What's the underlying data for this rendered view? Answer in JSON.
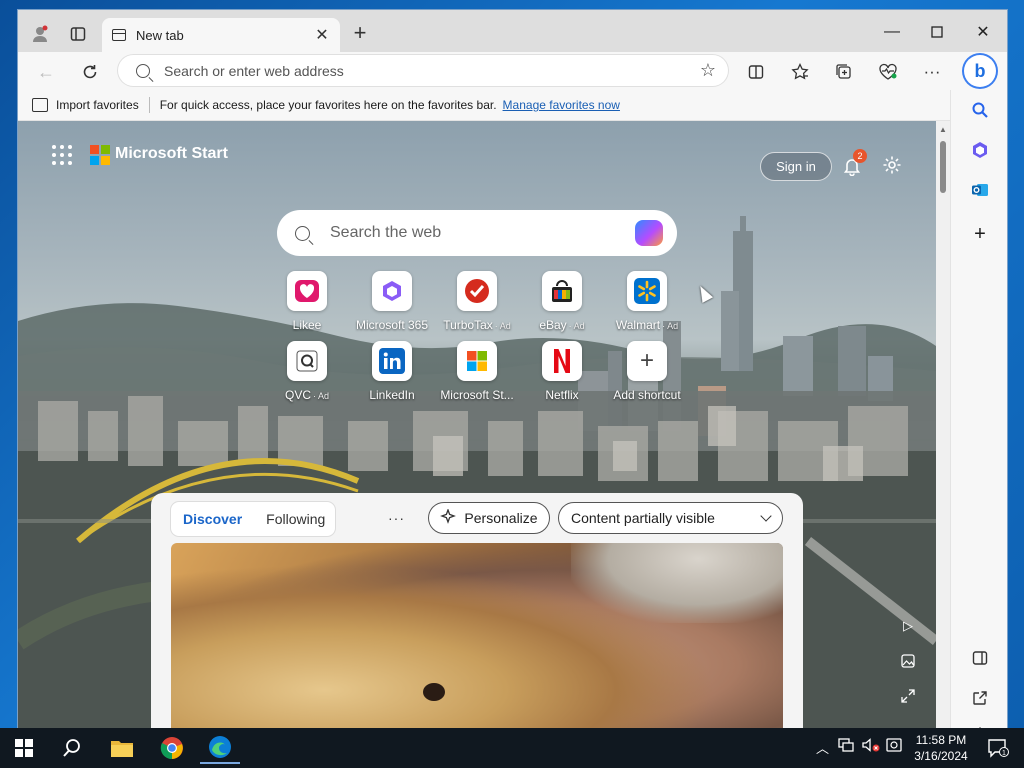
{
  "tab": {
    "title": "New tab"
  },
  "address": {
    "placeholder": "Search or enter web address"
  },
  "favorites_bar": {
    "import_label": "Import favorites",
    "message": "For quick access, place your favorites here on the favorites bar.",
    "manage_link": "Manage favorites now"
  },
  "page": {
    "brand": "Microsoft Start",
    "sign_in": "Sign in",
    "notification_count": "2",
    "search_placeholder": "Search the web"
  },
  "shortcuts": [
    {
      "label": "Likee",
      "ad": ""
    },
    {
      "label": "Microsoft 365",
      "ad": ""
    },
    {
      "label": "TurboTax",
      "ad": "Ad"
    },
    {
      "label": "eBay",
      "ad": "Ad"
    },
    {
      "label": "Walmart",
      "ad": "Ad"
    },
    {
      "label": "QVC",
      "ad": "Ad"
    },
    {
      "label": "LinkedIn",
      "ad": ""
    },
    {
      "label": "Microsoft St...",
      "ad": ""
    },
    {
      "label": "Netflix",
      "ad": ""
    },
    {
      "label": "Add shortcut",
      "ad": ""
    }
  ],
  "feed": {
    "tabs": [
      {
        "label": "Discover",
        "active": true
      },
      {
        "label": "Following",
        "active": false
      }
    ],
    "more": "···",
    "personalize": "Personalize",
    "content_visibility": "Content partially visible"
  },
  "taskbar": {
    "time": "11:58 PM",
    "date": "3/16/2024",
    "notification_count": "1"
  },
  "colors": {
    "accent": "#1b66c9",
    "badge": "#e8552c",
    "taskbar": "#101820"
  }
}
